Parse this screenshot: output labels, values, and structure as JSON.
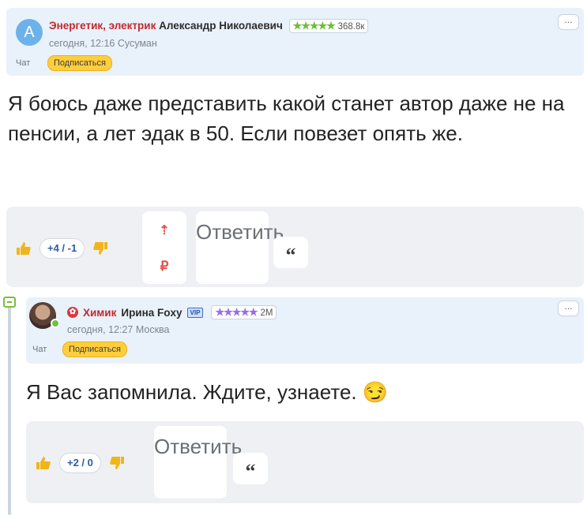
{
  "comment1": {
    "avatar_letter": "A",
    "profession": "Энергетик, электрик",
    "author": "Александр Николаевич",
    "stars": "★★★★★",
    "rating": "368.8к",
    "meta": "сегодня, 12:16  Сусуман",
    "chat_label": "Чат",
    "subscribe_label": "Подписаться",
    "more_label": "...",
    "text": "Я боюсь даже представить какой станет автор даже не на пенсии, а лет эдак в 50. Если повезет опять же.",
    "score": "+4 / -1",
    "donate_arrow": "⇡",
    "donate_currency": "₽",
    "reply_label": "Ответить",
    "quote_label": "“"
  },
  "comment2": {
    "profession": "Химик",
    "author": "Ирина Foxy",
    "vip_label": "VIP",
    "stars": "★★★★★",
    "rating": "2М",
    "meta": "сегодня, 12:27  Москва",
    "chat_label": "Чат",
    "subscribe_label": "Подписаться",
    "more_label": "...",
    "text": "Я Вас запомнила. Ждите, узнаете.",
    "emoji": "😏",
    "score": "+2 / 0",
    "reply_label": "Ответить",
    "quote_label": "“"
  },
  "colors": {
    "header_bg": "#e9f1fa",
    "profession_red": "#c2292b",
    "subscribe_yellow": "#ffce3d",
    "stars_green": "#6dbd3b",
    "stars_purple": "#9a6ee4",
    "like_yellow": "#f1b51c",
    "action_bar_bg": "#eef0f3"
  }
}
